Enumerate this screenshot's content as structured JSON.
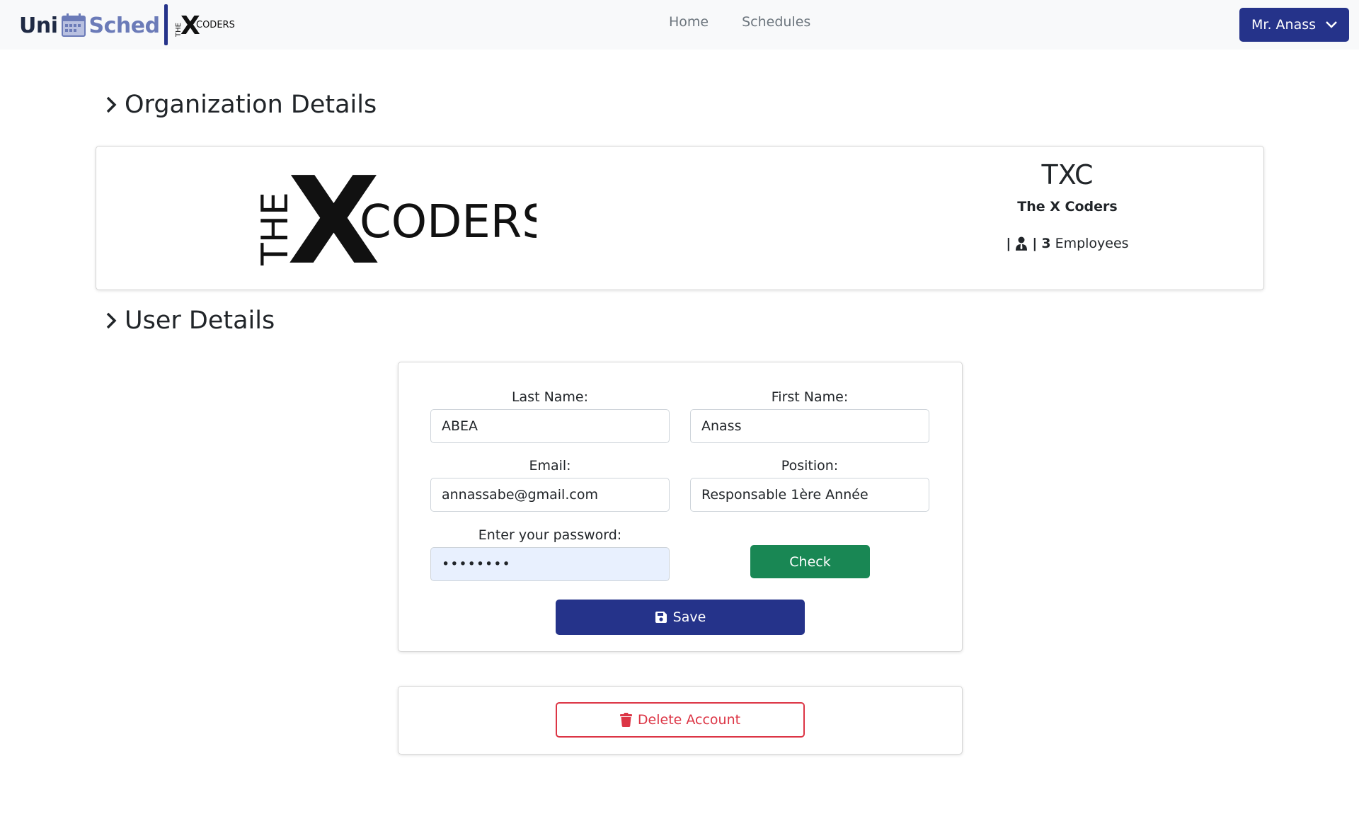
{
  "navbar": {
    "brand_uni": "Uni",
    "brand_sched": "Sched",
    "org_logo_text_the": "THE",
    "org_logo_text_x": "X",
    "org_logo_text_coders": "CODERS",
    "links": [
      "Home",
      "Schedules"
    ],
    "user_menu_label": "Mr. Anass",
    "brand_color": "#25338a"
  },
  "organization": {
    "section_title": "Organization Details",
    "logo_the": "THE",
    "logo_x": "X",
    "logo_coders": "CODERS",
    "abbreviation": "TXC",
    "full_name": "The X Coders",
    "employee_count": "3",
    "employee_label": "Employees",
    "separator": "|"
  },
  "user": {
    "section_title": "User Details",
    "last_name_label": "Last Name:",
    "last_name": "ABEA",
    "first_name_label": "First Name:",
    "first_name": "Anass",
    "email_label": "Email:",
    "email": "annassabe@gmail.com",
    "position_label": "Position:",
    "position": "Responsable 1ère Année",
    "password_label": "Enter your password:",
    "password_mask": "••••••••",
    "check_label": "Check",
    "save_label": "Save",
    "check_color": "#198754",
    "save_color": "#25338a"
  },
  "danger": {
    "delete_label": "Delete Account",
    "color": "#dc3545"
  }
}
